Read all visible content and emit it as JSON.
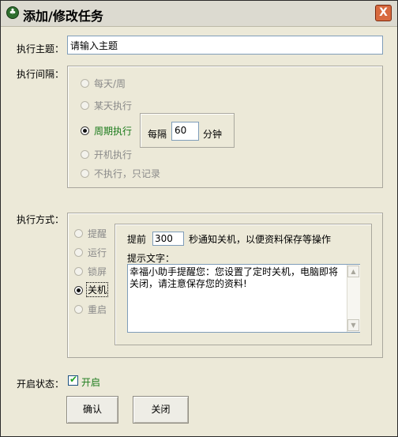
{
  "window": {
    "title": "添加/修改任务",
    "close_label": "X"
  },
  "subject": {
    "label": "执行主题：",
    "value": "请输入主题"
  },
  "interval": {
    "label": "执行间隔：",
    "options": [
      "每天/周",
      "某天执行",
      "周期执行",
      "开机执行",
      "不执行，只记录"
    ],
    "selected": "周期执行",
    "period": {
      "prefix": "每隔",
      "value": "60",
      "unit": "分钟"
    }
  },
  "mode": {
    "label": "执行方式：",
    "options": [
      "提醒",
      "运行",
      "锁屏",
      "关机",
      "重启"
    ],
    "selected": "关机",
    "detail": {
      "prefix": "提前",
      "seconds": "300",
      "suffix": "秒通知关机，以便资料保存等操作",
      "tip_label": "提示文字：",
      "tip_text": "幸福小助手提醒您：您设置了定时关机，电脑即将关闭，请注意保存您的资料!"
    }
  },
  "status": {
    "label": "开启状态：",
    "checkbox_label": "开启",
    "checked": true
  },
  "buttons": {
    "confirm": "确认",
    "close": "关闭"
  },
  "colors": {
    "window_bg": "#ece9d8",
    "selected_text": "#1a7a1a",
    "disabled_text": "#8a8a8a"
  }
}
